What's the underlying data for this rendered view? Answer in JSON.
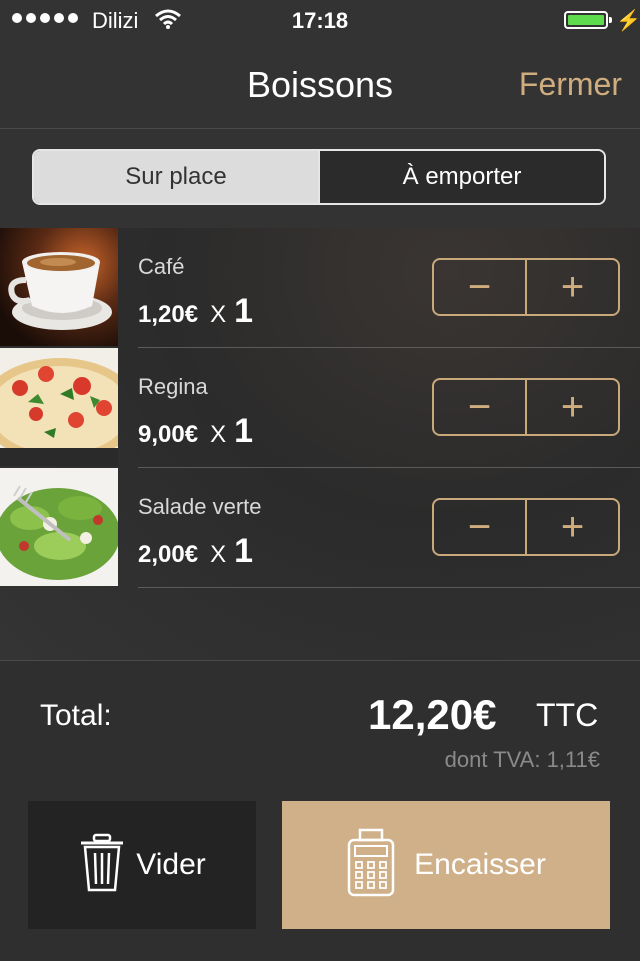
{
  "status": {
    "carrier": "Dilizi",
    "time": "17:18"
  },
  "nav": {
    "title": "Boissons",
    "close_label": "Fermer"
  },
  "segments": [
    {
      "label": "Sur place",
      "selected": true
    },
    {
      "label": "À emporter",
      "selected": false
    }
  ],
  "items": [
    {
      "name": "Café",
      "price": "1,20€",
      "x": "X",
      "qty": "1",
      "minus": "−",
      "plus": "+"
    },
    {
      "name": "Regina",
      "price": "9,00€",
      "x": "X",
      "qty": "1",
      "minus": "−",
      "plus": "+"
    },
    {
      "name": "Salade verte",
      "price": "2,00€",
      "x": "X",
      "qty": "1",
      "minus": "−",
      "plus": "+"
    }
  ],
  "summary": {
    "total_label": "Total:",
    "total_amount": "12,20€",
    "ttc": "TTC",
    "tva": "dont TVA: 1,11€"
  },
  "actions": {
    "clear_label": "Vider",
    "checkout_label": "Encaisser"
  },
  "colors": {
    "accent": "#cfad7f",
    "checkout_bg": "#cfb088",
    "battery": "#5fdc4e"
  },
  "icons": {
    "clear": "trash-icon",
    "checkout": "cash-register-icon"
  }
}
